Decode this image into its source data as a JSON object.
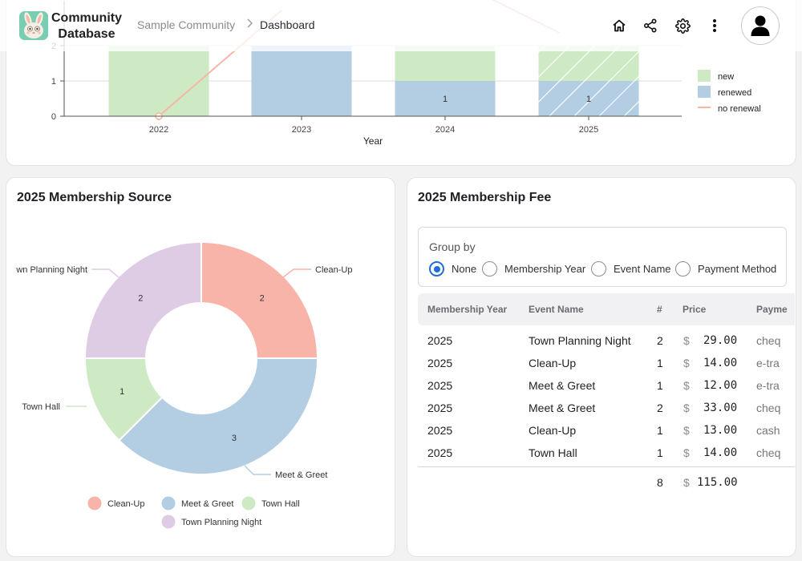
{
  "header": {
    "app_name_line1": "Community",
    "app_name_line2": "Database",
    "breadcrumb": [
      "Sample Community",
      "Dashboard"
    ],
    "icons": [
      "home-icon",
      "share-icon",
      "gear-icon",
      "more-vertical-icon",
      "user-avatar-icon"
    ]
  },
  "top_chart": {
    "chart_data": {
      "type": "bar",
      "xlabel": "Year",
      "categories": [
        "2022",
        "2023",
        "2024",
        "2025"
      ],
      "y_ticks": [
        "0",
        "1",
        "2"
      ],
      "series": [
        {
          "name": "new",
          "color": "#cdeac4",
          "values": [
            2,
            0,
            1,
            1
          ]
        },
        {
          "name": "renewed",
          "color": "#b3cde3",
          "values": [
            0,
            2,
            1,
            1
          ]
        },
        {
          "name": "no renewal",
          "color": "#f7b6a6",
          "values": [
            0,
            3,
            null,
            null
          ]
        }
      ],
      "data_labels": {
        "2024_renewed": "1",
        "2025_renewed": "1"
      },
      "legend": [
        "new",
        "renewed",
        "no renewal"
      ]
    }
  },
  "source_card": {
    "title": "2025 Membership Source",
    "chart_data": {
      "type": "pie",
      "slices": [
        {
          "label": "Clean-Up",
          "value": 2,
          "color": "#f9b4a9"
        },
        {
          "label": "Meet & Greet",
          "value": 3,
          "color": "#b3cde3"
        },
        {
          "label": "Town Hall",
          "value": 1,
          "color": "#cdeac4"
        },
        {
          "label": "Town Planning Night",
          "value": 2,
          "color": "#ddcce4"
        }
      ],
      "outer_labels": [
        "Clean-Up",
        "Meet & Greet",
        "Town Hall",
        "wn Planning Night"
      ],
      "legend": [
        "Clean-Up",
        "Meet & Greet",
        "Town Hall",
        "Town Planning Night"
      ]
    }
  },
  "fee_card": {
    "title": "2025 Membership Fee",
    "group_by": {
      "title": "Group by",
      "options": [
        "None",
        "Membership Year",
        "Event Name",
        "Payment Method"
      ],
      "selected": "None"
    },
    "columns": [
      "Membership Year",
      "Event Name",
      "#",
      "Price",
      "Payme"
    ],
    "currency": "$",
    "rows": [
      {
        "year": "2025",
        "event": "Town Planning Night",
        "count": "2",
        "price": "29.00",
        "payment": "cheq"
      },
      {
        "year": "2025",
        "event": "Clean-Up",
        "count": "1",
        "price": "14.00",
        "payment": "e-tra"
      },
      {
        "year": "2025",
        "event": "Meet & Greet",
        "count": "1",
        "price": "12.00",
        "payment": "e-tra"
      },
      {
        "year": "2025",
        "event": "Meet & Greet",
        "count": "2",
        "price": "33.00",
        "payment": "cheq"
      },
      {
        "year": "2025",
        "event": "Clean-Up",
        "count": "1",
        "price": "13.00",
        "payment": "cash"
      },
      {
        "year": "2025",
        "event": "Town Hall",
        "count": "1",
        "price": "14.00",
        "payment": "cheq"
      }
    ],
    "total": {
      "count": "8",
      "price": "115.00"
    }
  }
}
